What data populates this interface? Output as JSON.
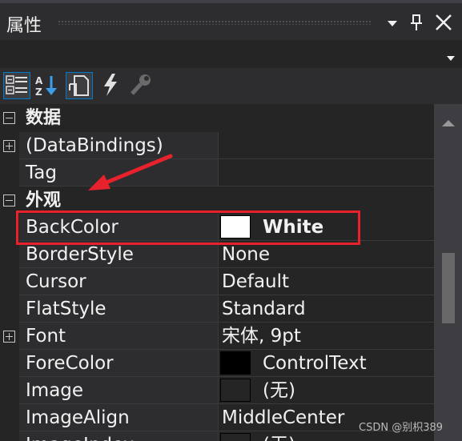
{
  "panel": {
    "title": "属性"
  },
  "toolbar": {
    "buttons": [
      {
        "name": "categorized-view-icon",
        "active": true
      },
      {
        "name": "alphabetical-sort-icon",
        "active": false
      },
      {
        "name": "properties-page-icon",
        "active": true
      },
      {
        "name": "events-lightning-icon",
        "active": false
      },
      {
        "name": "property-pages-wrench-icon",
        "active": false
      }
    ]
  },
  "categories": [
    {
      "label": "数据",
      "expanded": true
    },
    {
      "label": "外观",
      "expanded": true
    }
  ],
  "properties": [
    {
      "name": "(DataBindings)",
      "value": "",
      "expandable": true
    },
    {
      "name": "Tag",
      "value": ""
    },
    {
      "name": "BackColor",
      "value": "White",
      "swatch": "#ffffff",
      "bold": true
    },
    {
      "name": "BorderStyle",
      "value": "None"
    },
    {
      "name": "Cursor",
      "value": "Default"
    },
    {
      "name": "FlatStyle",
      "value": "Standard"
    },
    {
      "name": "Font",
      "value": "宋体, 9pt",
      "expandable": true
    },
    {
      "name": "ForeColor",
      "value": "ControlText",
      "swatch": "#000000"
    },
    {
      "name": "Image",
      "value": "(无)",
      "swatch": "#252526"
    },
    {
      "name": "ImageAlign",
      "value": "MiddleCenter"
    },
    {
      "name": "ImageIndex",
      "value": "(无)",
      "swatch": "#252526"
    }
  ],
  "colors": {
    "background": "#252526",
    "name_cell": "#2d2d30",
    "accent": "#007acc",
    "annotation_red": "#e8222c"
  },
  "watermark": "CSDN @别枳389"
}
